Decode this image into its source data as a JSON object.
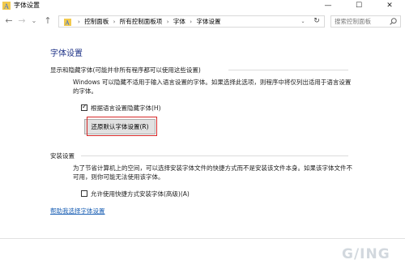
{
  "window": {
    "title": "字体设置",
    "controls": {
      "minimize": "—",
      "maximize": "☐",
      "close": "✕"
    }
  },
  "nav": {
    "back": "←",
    "forward": "→",
    "recent": "⌄",
    "up": "↑"
  },
  "address": {
    "crumbs": [
      "控制面板",
      "所有控制面板项",
      "字体",
      "字体设置"
    ],
    "dropdown": "⌄",
    "refresh": "↻"
  },
  "search": {
    "placeholder": "搜索控制面板"
  },
  "page": {
    "heading": "字体设置",
    "show_hide": {
      "label": "显示和隐藏字体(可能并非所有程序都可以使用这些设置)",
      "description": "Windows 可以隐藏不适用于输入语言设置的字体。如果选择此选项，则程序中将仅列出适用于语言设置的字体。",
      "checkbox_label": "根据语言设置隐藏字体(H)",
      "checkbox_checked": true,
      "restore_button": "还原默认字体设置(R)"
    },
    "install": {
      "label": "安装设置",
      "description": "为了节省计算机上的空间，可以选择安装字体文件的快捷方式而不是安装该文件本身。如果该字体文件不可用，则你可能无法使用该字体。",
      "checkbox_label": "允许使用快捷方式安装字体(高级)(A)",
      "checkbox_checked": false
    },
    "help_link": "帮助我选择字体设置"
  },
  "watermark": "G/ING",
  "colors": {
    "heading": "#1e3287",
    "link": "#1a5fb4",
    "highlight": "#d62828"
  }
}
